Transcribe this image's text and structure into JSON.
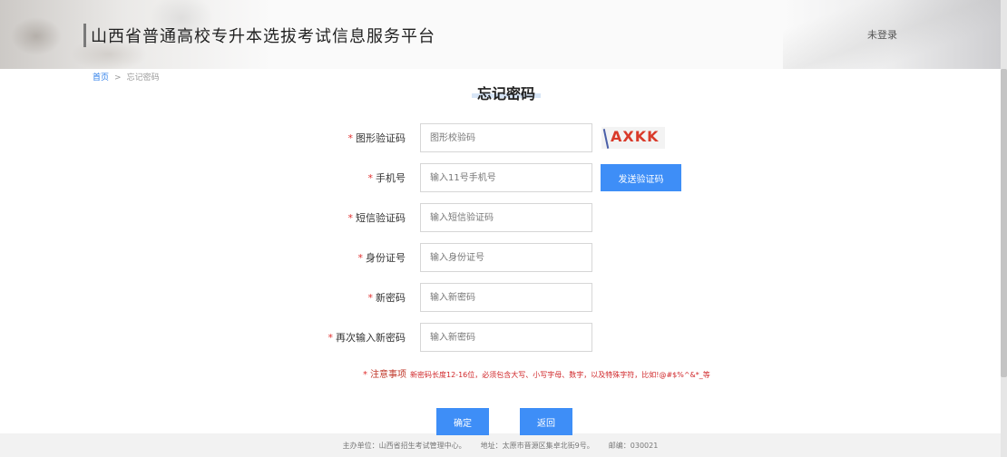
{
  "header": {
    "title": "山西省普通高校专升本选拔考试信息服务平台",
    "login_status": "未登录"
  },
  "breadcrumb": {
    "home": "首页",
    "separator": ">",
    "current": "忘记密码"
  },
  "page_title": "忘记密码",
  "form": {
    "required_mark": "*",
    "captcha": {
      "label": "图形验证码",
      "placeholder": "图形校验码",
      "image_text": "AXKK"
    },
    "phone": {
      "label": "手机号",
      "placeholder": "输入11号手机号",
      "send_button": "发送验证码"
    },
    "sms_code": {
      "label": "短信验证码",
      "placeholder": "输入短信验证码"
    },
    "id_number": {
      "label": "身份证号",
      "placeholder": "输入身份证号"
    },
    "new_password": {
      "label": "新密码",
      "placeholder": "输入新密码"
    },
    "confirm_password": {
      "label": "再次输入新密码",
      "placeholder": "输入新密码"
    },
    "notice_label": "注意事项",
    "notice_text": "新密码长度12-16位，必须包含大写、小写字母、数字，以及特殊字符，比如!@#$%^&*_等",
    "confirm_button": "确定",
    "back_button": "返回"
  },
  "footer": {
    "organizer": "主办单位：山西省招生考试管理中心。",
    "address": "地址：太原市晋源区集卓北街9号。",
    "postcode": "邮编：030021"
  },
  "colors": {
    "accent": "#3e8ef7",
    "required": "#e0302f",
    "notice": "#d0272a"
  }
}
